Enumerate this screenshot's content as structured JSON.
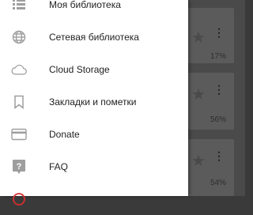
{
  "drawer": {
    "items": [
      {
        "label": "Моя библиотека",
        "icon": "list-icon"
      },
      {
        "label": "Сетевая библиотека",
        "icon": "globe-icon"
      },
      {
        "label": "Cloud Storage",
        "icon": "cloud-icon"
      },
      {
        "label": "Закладки и пометки",
        "icon": "bookmark-icon"
      },
      {
        "label": "Donate",
        "icon": "credit-card-icon"
      },
      {
        "label": "FAQ",
        "icon": "help-icon"
      }
    ]
  },
  "background": {
    "cards": [
      {
        "percent": "17%"
      },
      {
        "percent": "56%"
      },
      {
        "percent": "54%"
      }
    ]
  },
  "colors": {
    "drawer_bg": "#ffffff",
    "icon": "#9e9e9e",
    "text": "#222222",
    "overlay": "#4a4a4a",
    "exit_icon": "#d32f2f"
  }
}
